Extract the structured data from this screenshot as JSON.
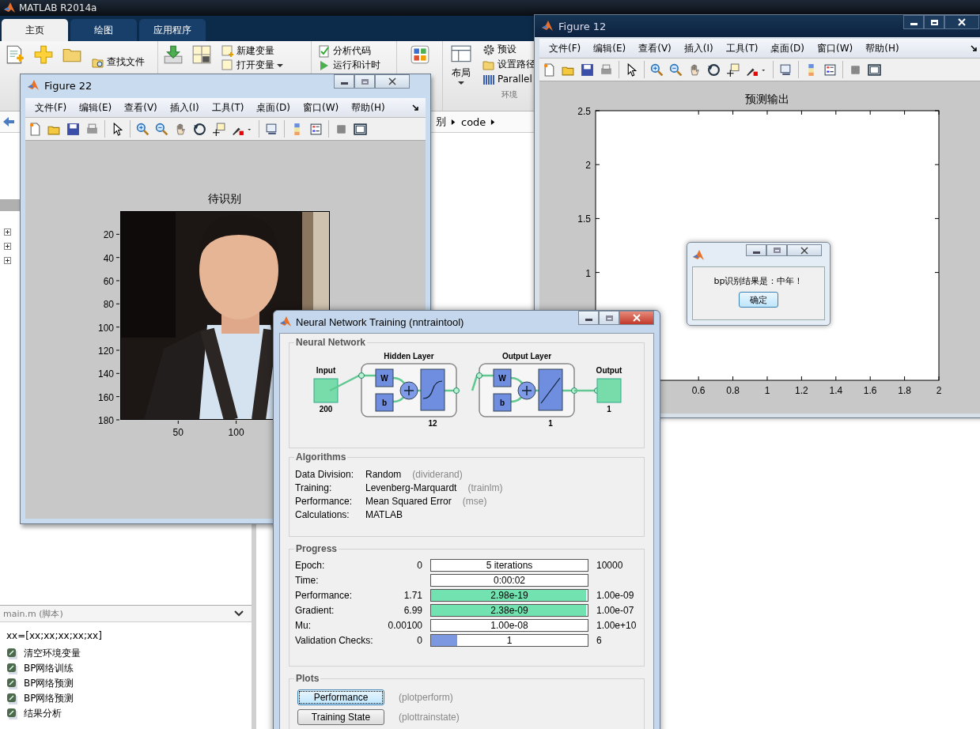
{
  "main_window": {
    "title": "MATLAB R2014a",
    "tabs": [
      {
        "label": "主页",
        "selected": true
      },
      {
        "label": "绘图",
        "selected": false
      },
      {
        "label": "应用程序",
        "selected": false
      }
    ],
    "ribbon": {
      "find_files": "查找文件",
      "new_variable": "新建变量",
      "open_variable": "打开变量",
      "analyze_code": "分析代码",
      "run_and_time": "运行和计时",
      "layout": "布局",
      "preferences": "预设",
      "set_path": "设置路径",
      "parallel": "Parallel",
      "section_label": "环境"
    },
    "path": [
      "别",
      "code"
    ],
    "details": {
      "title": "main.m (脚本)",
      "line": "xx=[xx;xx;xx;xx;xx]",
      "sections": [
        "清空环境变量",
        "BP网络训练",
        "BP网络预测",
        "BP网络预测",
        "结果分析"
      ]
    }
  },
  "figure_12": {
    "title": "Figure 12",
    "menu": [
      "文件(F)",
      "编辑(E)",
      "查看(V)",
      "插入(I)",
      "工具(T)",
      "桌面(D)",
      "窗口(W)",
      "帮助(H)"
    ],
    "chart_data": {
      "type": "line",
      "title": "预测输出",
      "xlim": [
        0,
        2
      ],
      "ylim": [
        0,
        2.5
      ],
      "xticks": [
        0.6,
        0.8,
        1,
        1.2,
        1.4,
        1.6,
        1.8,
        2
      ],
      "yticks": [
        1,
        1.5,
        2,
        2.5
      ]
    }
  },
  "figure_22": {
    "title": "Figure 22",
    "menu": [
      "文件(F)",
      "编辑(E)",
      "查看(V)",
      "插入(I)",
      "工具(T)",
      "桌面(D)",
      "窗口(W)",
      "帮助(H)"
    ],
    "axes": {
      "title": "待识别",
      "yticks": [
        "20",
        "40",
        "60",
        "80",
        "100",
        "120",
        "140",
        "160",
        "180"
      ],
      "xticks": [
        "50",
        "100"
      ],
      "image": {
        "kind": "picture"
      }
    }
  },
  "result_dialog": {
    "message": "bp识别结果是：中年！",
    "button": "确定"
  },
  "nntraintool": {
    "title": "Neural Network Training (nntraintool)",
    "network": {
      "heading": "Neural Network",
      "input": {
        "label": "Input",
        "size": "200"
      },
      "layers": [
        {
          "label": "Hidden Layer",
          "size": "12",
          "weight": "W",
          "bias": "b",
          "kind": "sigmoid"
        },
        {
          "label": "Output Layer",
          "size": "1",
          "weight": "W",
          "bias": "b",
          "kind": "linear"
        }
      ],
      "output": {
        "label": "Output",
        "size": "1"
      }
    },
    "algorithms": {
      "heading": "Algorithms",
      "rows": [
        {
          "label": "Data Division:",
          "value": "Random",
          "function": "(dividerand)"
        },
        {
          "label": "Training:",
          "value": "Levenberg-Marquardt",
          "function": "(trainlm)"
        },
        {
          "label": "Performance:",
          "value": "Mean Squared Error",
          "function": "(mse)"
        },
        {
          "label": "Calculations:",
          "value": "MATLAB"
        }
      ]
    },
    "progress": {
      "heading": "Progress",
      "rows": [
        {
          "label": "Epoch:",
          "start": "0",
          "value": "5 iterations",
          "end": "10000"
        },
        {
          "label": "Time:",
          "value": "0:00:02"
        },
        {
          "label": "Performance:",
          "start": "1.71",
          "value": "2.98e-19",
          "end": "1.00e-09",
          "level": 0.99,
          "color": "#72e3b0"
        },
        {
          "label": "Gradient:",
          "start": "6.99",
          "value": "2.38e-09",
          "end": "1.00e-07",
          "level": 0.99,
          "color": "#72e3b0"
        },
        {
          "label": "Mu:",
          "start": "0.00100",
          "value": "1.00e-08",
          "end": "1.00e+10"
        },
        {
          "label": "Validation Checks:",
          "start": "0",
          "value": "1",
          "end": "6",
          "level": 0.167,
          "color": "#7c98e0"
        }
      ]
    },
    "plots": {
      "heading": "Plots",
      "buttons": [
        {
          "label": "Performance",
          "function": "(plotperform)",
          "focused": true
        },
        {
          "label": "Training State",
          "function": "(plottrainstate)",
          "focused": false
        }
      ]
    }
  }
}
